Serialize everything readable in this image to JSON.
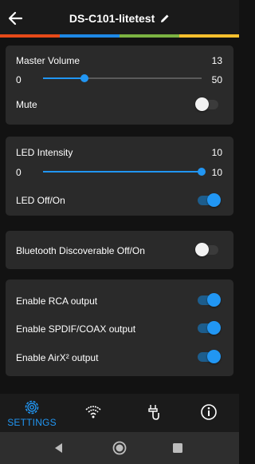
{
  "header": {
    "title": "DS-C101-litetest"
  },
  "colors": {
    "strip": [
      "#e64a19",
      "#1e88e5",
      "#7cb342",
      "#fbc02d"
    ],
    "accent": "#2196f3"
  },
  "volume": {
    "label": "Master Volume",
    "value": "13",
    "min": "0",
    "max": "50",
    "slider_fraction": 0.26,
    "mute_label": "Mute",
    "mute_on": false
  },
  "led": {
    "label": "LED Intensity",
    "value": "10",
    "min": "0",
    "max": "10",
    "slider_fraction": 1.0,
    "toggle_label": "LED Off/On",
    "toggle_on": true
  },
  "bluetooth": {
    "label": "Bluetooth Discoverable Off/On",
    "on": false
  },
  "outputs": [
    {
      "label": "Enable RCA output",
      "on": true
    },
    {
      "label": "Enable SPDIF/COAX output",
      "on": true
    },
    {
      "label": "Enable AirX² output",
      "on": true
    }
  ],
  "bottom_nav": {
    "settings_label": "SETTINGS",
    "items": [
      "gear-icon",
      "wifi-icon",
      "usb-cable-icon",
      "info-icon"
    ]
  }
}
